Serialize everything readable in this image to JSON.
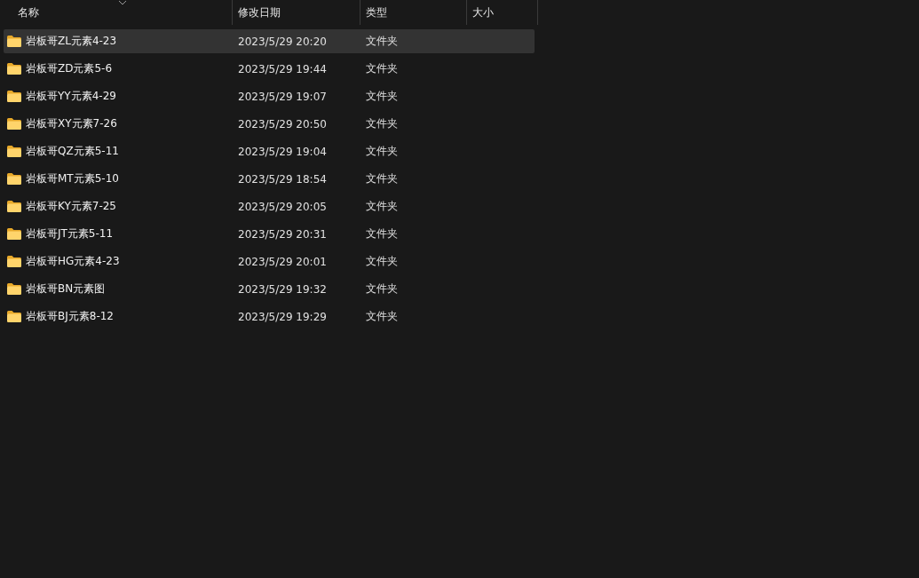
{
  "columns": [
    {
      "label": "名称",
      "sorted": true
    },
    {
      "label": "修改日期",
      "sorted": false
    },
    {
      "label": "类型",
      "sorted": false
    },
    {
      "label": "大小",
      "sorted": false
    }
  ],
  "rows": [
    {
      "name": "岩板哥ZL元素4-23",
      "modified": "2023/5/29 20:20",
      "type": "文件夹",
      "selected": true
    },
    {
      "name": "岩板哥ZD元素5-6",
      "modified": "2023/5/29 19:44",
      "type": "文件夹",
      "selected": false
    },
    {
      "name": "岩板哥YY元素4-29",
      "modified": "2023/5/29 19:07",
      "type": "文件夹",
      "selected": false
    },
    {
      "name": "岩板哥XY元素7-26",
      "modified": "2023/5/29 20:50",
      "type": "文件夹",
      "selected": false
    },
    {
      "name": "岩板哥QZ元素5-11",
      "modified": "2023/5/29 19:04",
      "type": "文件夹",
      "selected": false
    },
    {
      "name": "岩板哥MT元素5-10",
      "modified": "2023/5/29 18:54",
      "type": "文件夹",
      "selected": false
    },
    {
      "name": "岩板哥KY元素7-25",
      "modified": "2023/5/29 20:05",
      "type": "文件夹",
      "selected": false
    },
    {
      "name": "岩板哥JT元素5-11",
      "modified": "2023/5/29 20:31",
      "type": "文件夹",
      "selected": false
    },
    {
      "name": "岩板哥HG元素4-23",
      "modified": "2023/5/29 20:01",
      "type": "文件夹",
      "selected": false
    },
    {
      "name": "岩板哥BN元素图",
      "modified": "2023/5/29 19:32",
      "type": "文件夹",
      "selected": false
    },
    {
      "name": "岩板哥BJ元素8-12",
      "modified": "2023/5/29 19:29",
      "type": "文件夹",
      "selected": false
    }
  ]
}
